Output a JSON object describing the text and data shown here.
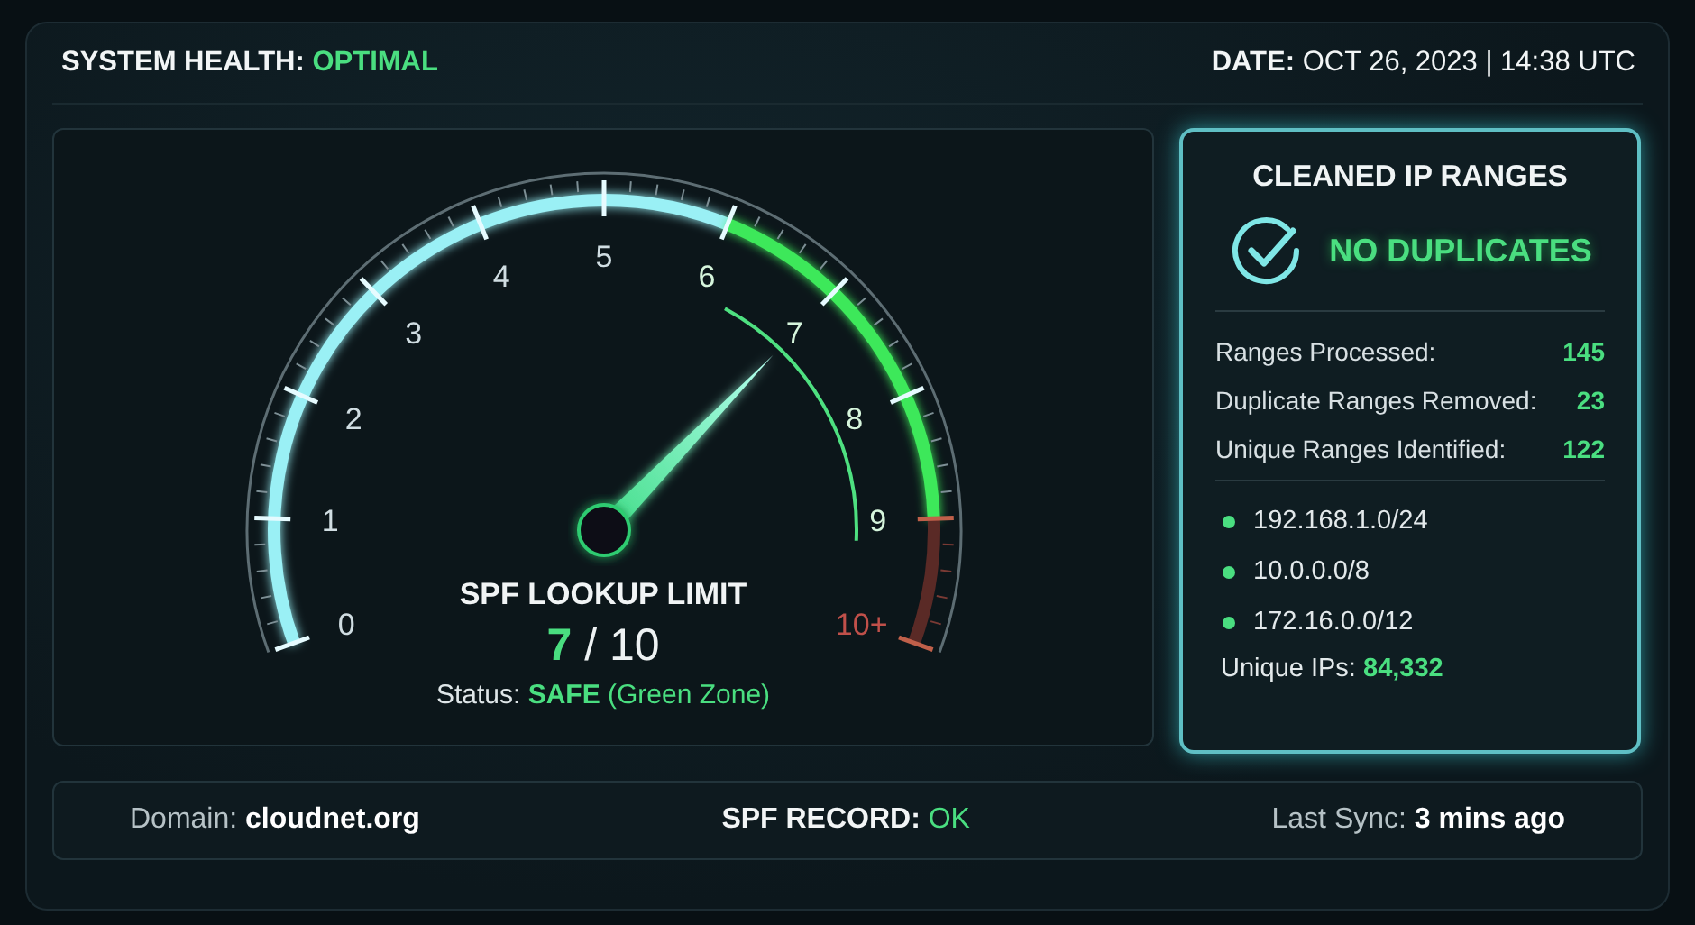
{
  "header": {
    "health_label": "SYSTEM HEALTH:",
    "health_value": "OPTIMAL",
    "date_label": "DATE:",
    "date_value": "OCT 26, 2023 | 14:38 UTC"
  },
  "gauge": {
    "ticks": [
      "0",
      "1",
      "2",
      "3",
      "4",
      "5",
      "6",
      "7",
      "8",
      "9",
      "10+"
    ],
    "title": "SPF LOOKUP LIMIT",
    "value": "7",
    "total": "/ 10",
    "status_label": "Status:",
    "status_value": "SAFE",
    "status_note": "(Green Zone)"
  },
  "ranges_card": {
    "title": "CLEANED IP RANGES",
    "badge": "NO DUPLICATES",
    "stats": [
      {
        "label": "Ranges Processed:",
        "value": "145"
      },
      {
        "label": "Duplicate Ranges Removed:",
        "value": "23"
      },
      {
        "label": "Unique Ranges Identified:",
        "value": "122"
      }
    ],
    "ranges": [
      {
        "text": "192.168.1.0/24",
        "color": "#4ade80"
      },
      {
        "text": "10.0.0.0/8",
        "color": "#4ade80"
      },
      {
        "text": "172.16.0.0/12",
        "color": "#4ade80"
      }
    ],
    "unique_label": "Unique IPs:",
    "unique_value": "84,332"
  },
  "footer": [
    {
      "label": "Domain:",
      "value": "cloudnet.org",
      "kind": "plain"
    },
    {
      "label": "SPF RECORD:",
      "value": "OK",
      "kind": "status"
    },
    {
      "label": "Last Sync:",
      "value": "3 mins ago",
      "kind": "plain"
    }
  ]
}
